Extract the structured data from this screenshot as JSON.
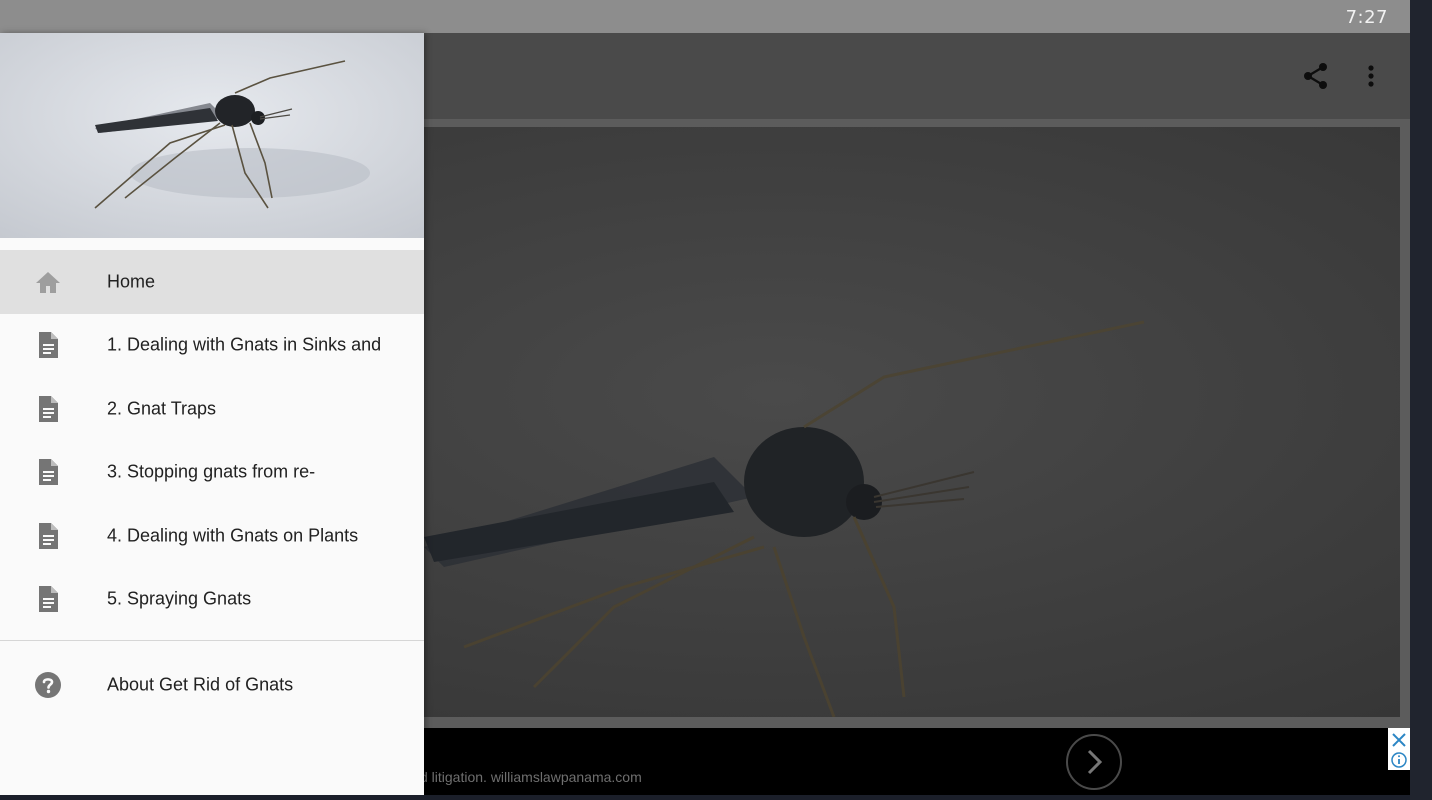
{
  "status_bar": {
    "time": "7:27"
  },
  "app_bar": {
    "share_icon": "share-icon",
    "more_icon": "more-vert-icon"
  },
  "drawer": {
    "header_image": "gnat-photo",
    "items": [
      {
        "label": "Home",
        "icon": "home-icon",
        "active": true
      },
      {
        "label": "1. Dealing with Gnats in Sinks and",
        "icon": "document-icon"
      },
      {
        "label": "2. Gnat Traps",
        "icon": "document-icon"
      },
      {
        "label": "3. Stopping gnats from re-",
        "icon": "document-icon"
      },
      {
        "label": "4. Dealing with Gnats on Plants",
        "icon": "document-icon"
      },
      {
        "label": "5. Spraying Gnats",
        "icon": "document-icon"
      }
    ],
    "about": {
      "label": "About Get Rid of Gnats",
      "icon": "help-icon"
    }
  },
  "ad": {
    "text": "d litigation. williamslawpanama.com",
    "next_icon": "chevron-right-icon",
    "close_icon": "close-icon",
    "info_icon": "info-icon"
  },
  "colors": {
    "drawer_bg": "#fafafa",
    "active_item_bg": "#e0e0e0",
    "icon_gray": "#757575",
    "active_icon_gray": "#9e9e9e"
  }
}
